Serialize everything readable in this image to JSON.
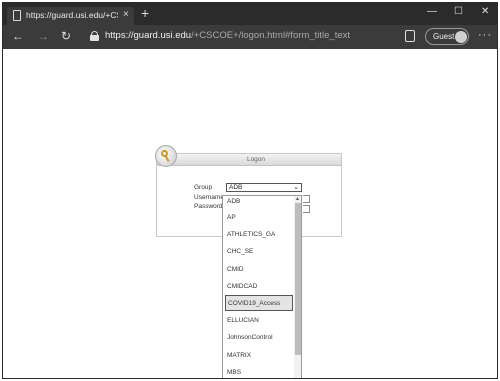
{
  "browser": {
    "tab_title": "https://guard.usi.edu/+CSCOE+/logon",
    "tab_close": "×",
    "new_tab": "+",
    "window_minimize": "—",
    "window_maximize": "☐",
    "window_close": "✕",
    "nav_back": "←",
    "nav_forward": "→",
    "nav_refresh": "↻",
    "url_host": "https://guard.usi.edu",
    "url_path": "/+CSCOE+/logon.html#form_title_text",
    "profile_label": "Guest",
    "more_menu": "···",
    "icons": [
      "document-icon",
      "lock-icon",
      "reading-view-icon",
      "avatar-icon"
    ]
  },
  "logon": {
    "title": "Logon",
    "group_label": "Group",
    "username_label": "Username",
    "password_label": "Password",
    "group_value": "ADB",
    "group_chevron": "⌄",
    "logo_icon": "key-icon"
  },
  "dropdown": {
    "options": [
      "ADB",
      "AP",
      "ATHLETICS_GA",
      "CHC_SE",
      "CMID",
      "CMIDCAD",
      "COVID19_Access",
      "ELLUCIAN",
      "JohnsonControl",
      "MATRIX",
      "MBS"
    ],
    "highlighted": "COVID19_Access",
    "scroll_up": "▲"
  }
}
